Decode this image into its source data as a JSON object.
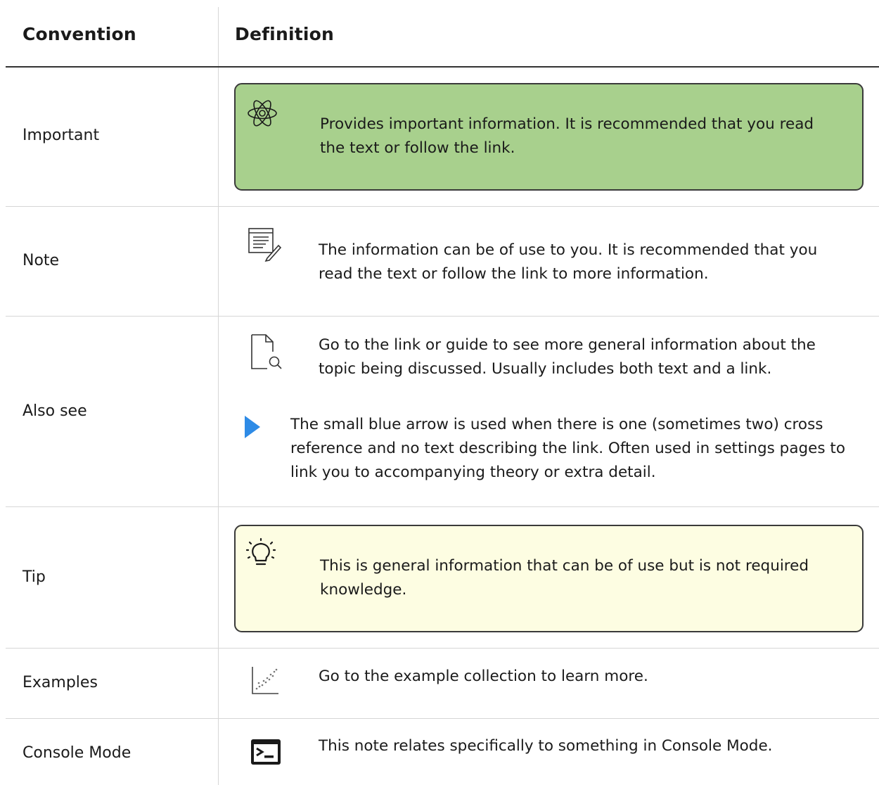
{
  "header": {
    "convention": "Convention",
    "definition": "Definition"
  },
  "rows": [
    {
      "label": "Important",
      "text": "Provides important information. It is recommended that you read the text or follow the link.",
      "icon": "atom-icon",
      "box_color": "#a8d08d"
    },
    {
      "label": "Note",
      "text": "The information can be of use to you. It is recommended that you read the text or follow the link to more information.",
      "icon": "note-pencil-icon"
    },
    {
      "label": "Also see",
      "text": "Go to the link or guide to see more general information about the topic being discussed. Usually includes both text and a link.",
      "icon": "document-search-icon",
      "arrow_text": "The small blue arrow is used when there is one (sometimes two) cross reference and no text describing the link. Often used in settings pages to link you to accompanying theory or extra detail.",
      "arrow_icon": "blue-arrow-icon",
      "arrow_color": "#2e8be6"
    },
    {
      "label": "Tip",
      "text": "This is general information that can be of use but is not required knowledge.",
      "icon": "lightbulb-icon",
      "box_color": "#fdfde2"
    },
    {
      "label": "Examples",
      "text": "Go to the example collection to learn more.",
      "icon": "scatter-chart-icon"
    },
    {
      "label": "Console Mode",
      "text": "This note relates specifically to something in Console Mode.",
      "icon": "console-icon"
    }
  ]
}
